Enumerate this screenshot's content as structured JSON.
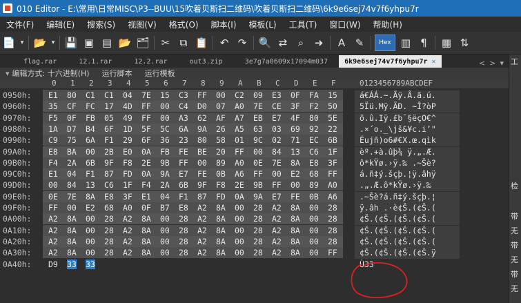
{
  "window": {
    "title": "010 Editor - E:\\常用\\日常MISC\\P3--BUU\\15吹着贝斯扫二维码\\吹着贝斯扫二维码\\6k9e6sej74v7f6yhpu7r"
  },
  "menu": [
    "文件(F)",
    "编辑(E)",
    "搜索(S)",
    "视图(V)",
    "格式(O)",
    "脚本(I)",
    "模板(L)",
    "工具(T)",
    "窗口(W)",
    "帮助(H)"
  ],
  "toolbar": {
    "icons": [
      "new-file-icon",
      "dropdown-icon",
      "open-folder-icon",
      "dropdown-icon",
      "save-icon",
      "save-as-icon",
      "save-all-icon",
      "open-folder-icon",
      "folder-stack-icon",
      "cut-icon",
      "copy-icon",
      "paste-icon",
      "undo-icon",
      "redo-icon",
      "find-icon",
      "replace-icon",
      "find-in-files-icon",
      "goto-icon",
      "font-icon",
      "highlight-icon",
      "hex-mode-icon",
      "columns-icon",
      "pilcrow-icon",
      "calculator-icon",
      "compare-icon"
    ],
    "hex_label": "Hex"
  },
  "tabs": [
    {
      "label": "flag.rar",
      "active": false
    },
    {
      "label": "12.1.rar",
      "active": false
    },
    {
      "label": "12.2.rar",
      "active": false
    },
    {
      "label": "out3.zip",
      "active": false
    },
    {
      "label": "3e7g7a0609x17094m037",
      "active": false
    },
    {
      "label": "6k9e6sej74v7f6yhpu7r",
      "active": true
    }
  ],
  "editbar": {
    "edit_mode": "编辑方式: 十六进制(H)",
    "run_script": "运行脚本",
    "run_template": "运行模板"
  },
  "columns": {
    "hex": [
      "0",
      "1",
      "2",
      "3",
      "4",
      "5",
      "6",
      "7",
      "8",
      "9",
      "A",
      "B",
      "C",
      "D",
      "E",
      "F"
    ],
    "ascii": "0123456789ABCDEF"
  },
  "rows": [
    {
      "addr": "0950h:",
      "bytes": [
        "E1",
        "80",
        "C1",
        "C1",
        "04",
        "7E",
        "15",
        "C3",
        "FF",
        "00",
        "C2",
        "09",
        "E3",
        "0F",
        "FA",
        "15"
      ],
      "ascii": "á€ÁÁ.~.Ãÿ.Â.ã.ú."
    },
    {
      "addr": "0960h:",
      "bytes": [
        "35",
        "CF",
        "FC",
        "17",
        "4D",
        "FF",
        "00",
        "C4",
        "D0",
        "07",
        "A0",
        "7E",
        "CE",
        "3F",
        "F2",
        "50"
      ],
      "ascii": "5Ïü.Mÿ.ÄÐ. ~Î?òP"
    },
    {
      "addr": "0970h:",
      "bytes": [
        "F5",
        "0F",
        "FB",
        "05",
        "49",
        "FF",
        "00",
        "A3",
        "62",
        "AF",
        "A7",
        "EB",
        "E7",
        "4F",
        "80",
        "5E"
      ],
      "ascii": "õ.û.Iÿ.£b¯§ëçO€^"
    },
    {
      "addr": "0980h:",
      "bytes": [
        "1A",
        "D7",
        "B4",
        "6F",
        "1D",
        "5F",
        "5C",
        "6A",
        "9A",
        "26",
        "A5",
        "63",
        "03",
        "69",
        "92",
        "22"
      ],
      "ascii": ".×´o._\\jš&¥c.i’\""
    },
    {
      "addr": "0990h:",
      "bytes": [
        "C9",
        "75",
        "6A",
        "F1",
        "29",
        "6F",
        "36",
        "23",
        "80",
        "58",
        "01",
        "9C",
        "02",
        "71",
        "EC",
        "6B"
      ],
      "ascii": "Éujñ)o6#€X.œ.qìk"
    },
    {
      "addr": "09A0h:",
      "bytes": [
        "E8",
        "BA",
        "00",
        "2B",
        "E0",
        "0A",
        "FB",
        "FE",
        "BE",
        "20",
        "FF",
        "00",
        "84",
        "13",
        "C6",
        "1F"
      ],
      "ascii": "èº.+à.ûþ¾ ÿ.„.Æ."
    },
    {
      "addr": "09B0h:",
      "bytes": [
        "F4",
        "2A",
        "6B",
        "9F",
        "F8",
        "2E",
        "9B",
        "FF",
        "00",
        "89",
        "A0",
        "0E",
        "7E",
        "8A",
        "E8",
        "3F"
      ],
      "ascii": "ô*kŸø.›ÿ.‰ .~Šè?"
    },
    {
      "addr": "09C0h:",
      "bytes": [
        "E1",
        "04",
        "F1",
        "87",
        "FD",
        "0A",
        "9A",
        "E7",
        "FE",
        "0B",
        "A6",
        "FF",
        "00",
        "E2",
        "68",
        "FF"
      ],
      "ascii": "á.ñ‡ý.šçþ.¦ÿ.âhÿ"
    },
    {
      "addr": "09D0h:",
      "bytes": [
        "00",
        "84",
        "13",
        "C6",
        "1F",
        "F4",
        "2A",
        "6B",
        "9F",
        "F8",
        "2E",
        "9B",
        "FF",
        "00",
        "89",
        "A0"
      ],
      "ascii": ".„.Æ.ô*kŸø.›ÿ.‰ "
    },
    {
      "addr": "09E0h:",
      "bytes": [
        "0E",
        "7E",
        "8A",
        "E8",
        "3F",
        "E1",
        "04",
        "F1",
        "87",
        "FD",
        "0A",
        "9A",
        "E7",
        "FE",
        "0B",
        "A6"
      ],
      "ascii": ".~Šè?á.ñ‡ý.šçþ.¦"
    },
    {
      "addr": "09F0h:",
      "bytes": [
        "FF",
        "00",
        "E2",
        "68",
        "A0",
        "0F",
        "B7",
        "E8",
        "A2",
        "8A",
        "00",
        "28",
        "A2",
        "8A",
        "00",
        "28"
      ],
      "ascii": "ÿ.âh .·è¢Š.(¢Š.("
    },
    {
      "addr": "0A00h:",
      "bytes": [
        "A2",
        "8A",
        "00",
        "28",
        "A2",
        "8A",
        "00",
        "28",
        "A2",
        "8A",
        "00",
        "28",
        "A2",
        "8A",
        "00",
        "28"
      ],
      "ascii": "¢Š.(¢Š.(¢Š.(¢Š.("
    },
    {
      "addr": "0A10h:",
      "bytes": [
        "A2",
        "8A",
        "00",
        "28",
        "A2",
        "8A",
        "00",
        "28",
        "A2",
        "8A",
        "00",
        "28",
        "A2",
        "8A",
        "00",
        "28"
      ],
      "ascii": "¢Š.(¢Š.(¢Š.(¢Š.("
    },
    {
      "addr": "0A20h:",
      "bytes": [
        "A2",
        "8A",
        "00",
        "28",
        "A2",
        "8A",
        "00",
        "28",
        "A2",
        "8A",
        "00",
        "28",
        "A2",
        "8A",
        "00",
        "28"
      ],
      "ascii": "¢Š.(¢Š.(¢Š.(¢Š.("
    },
    {
      "addr": "0A30h:",
      "bytes": [
        "A2",
        "8A",
        "00",
        "28",
        "A2",
        "8A",
        "00",
        "28",
        "A2",
        "8A",
        "00",
        "28",
        "A2",
        "8A",
        "00",
        "FF"
      ],
      "ascii": "¢Š.(¢Š.(¢Š.(¢Š.ÿ"
    },
    {
      "addr": "0A40h:",
      "bytes": [
        "D9",
        "33",
        "33"
      ],
      "ascii": "Ù33",
      "selected": [
        1,
        2
      ]
    }
  ],
  "right_panel": [
    "工",
    "检",
    "带",
    "无",
    "带",
    "无",
    "带",
    "无"
  ],
  "colors": {
    "titlebar": "#1e6fb8",
    "selection": "#2d7fd4",
    "annotation": "#e02020"
  }
}
